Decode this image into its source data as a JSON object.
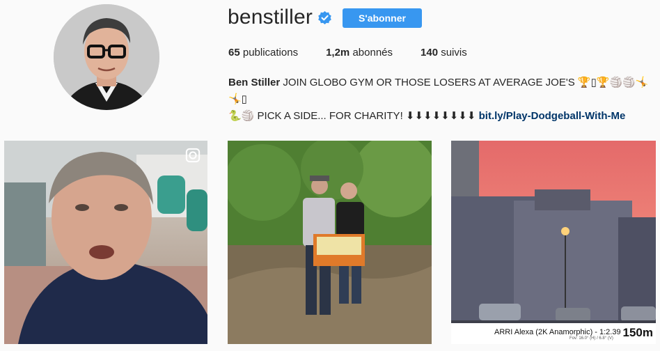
{
  "profile": {
    "username": "benstiller",
    "verified": true,
    "follow_label": "S'abonner",
    "stats": {
      "posts": "65",
      "posts_label": "publications",
      "followers": "1,2m",
      "followers_label": "abonnés",
      "following": "140",
      "following_label": "suivis"
    },
    "bio": {
      "name": "Ben Stiller",
      "line1": "JOIN GLOBO GYM OR THOSE LOSERS AT AVERAGE JOE'S 🏆▯🏆🏐🏐🤸🤸▯",
      "line2": "🐍🏐 PICK A SIDE... FOR CHARITY! ⬇⬇⬇⬇⬇⬇⬇⬇",
      "link": "bit.ly/Play-Dodgeball-With-Me"
    }
  },
  "posts": [
    {
      "kind": "video",
      "icon": "video-camera-icon"
    },
    {
      "kind": "photo"
    },
    {
      "kind": "photo",
      "overlay": {
        "camera": "ARRI Alexa (2K Anamorphic) - 1:2.39",
        "fov": "Fov: 16.0° (H) / 6.8° (V)",
        "distance": "150m"
      }
    }
  ],
  "colors": {
    "accent": "#3897f0",
    "link": "#003569",
    "background": "#fafafa"
  }
}
